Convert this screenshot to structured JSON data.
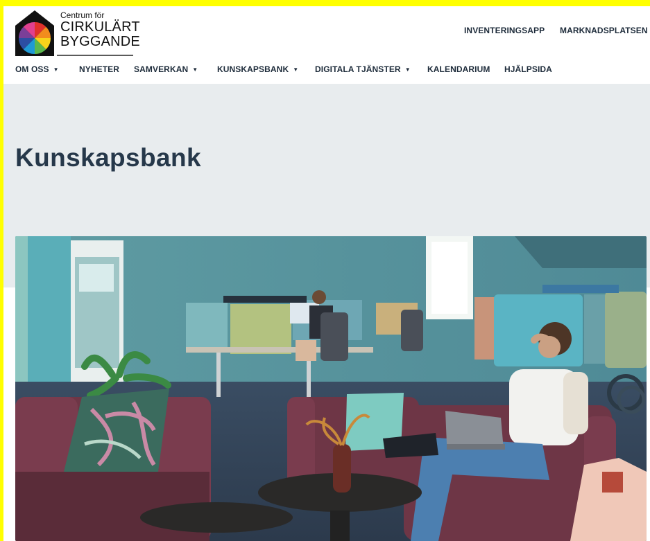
{
  "logo": {
    "line1": "Centrum för",
    "line2": "CIRKULÄRT",
    "line3": "BYGGANDE",
    "wheel_colors": [
      "#e0312b",
      "#f28c1d",
      "#f7d31b",
      "#5bb84d",
      "#1f9ad6",
      "#2c4ea3",
      "#7a3f98",
      "#e0408f"
    ]
  },
  "utility_nav": {
    "inventering": "INVENTERINGSAPP",
    "marknad": "MARKNADSPLATSEN"
  },
  "main_nav": {
    "items": [
      {
        "label": "OM OSS",
        "caret": true
      },
      {
        "label": "NYHETER",
        "caret": false
      },
      {
        "label": "SAMVERKAN",
        "caret": true
      },
      {
        "label": "KUNSKAPSBANK",
        "caret": true,
        "active": true
      },
      {
        "label": "DIGITALA TJÄNSTER",
        "caret": true
      },
      {
        "label": "KALENDARIUM",
        "caret": false
      },
      {
        "label": "HJÄLPSIDA",
        "caret": false
      }
    ],
    "caret_glyph": "▼"
  },
  "hero": {
    "title": "Kunskapsbank"
  },
  "photo": {
    "icon": "office-lounge-photo"
  },
  "colors": {
    "nav_text": "#1d2b3a",
    "hero_bg": "#e8ecee",
    "title": "#26384a",
    "frame": "#ffff00"
  }
}
